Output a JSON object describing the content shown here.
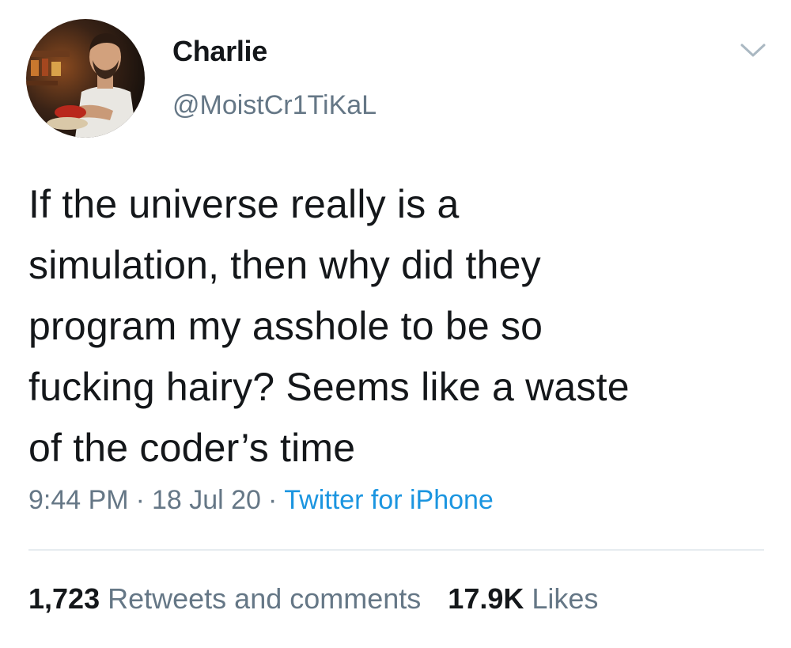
{
  "author": {
    "display_name": "Charlie",
    "handle": "@MoistCr1TiKaL",
    "avatar_icon": "profile-photo"
  },
  "menu": {
    "icon": "chevron-down-icon",
    "color": "#aab8c2"
  },
  "tweet": {
    "text_lines": [
      "If the universe really is a",
      "simulation, then why did they",
      "program my asshole to be so",
      "fucking hairy? Seems like a waste",
      "of the coder’s time"
    ],
    "time": "9:44 PM",
    "date": "18 Jul 20",
    "separator": "·",
    "source": "Twitter for iPhone"
  },
  "stats": {
    "retweets_count": "1,723",
    "retweets_label": "Retweets and comments",
    "likes_count": "17.9K",
    "likes_label": "Likes"
  },
  "colors": {
    "text": "#14171a",
    "secondary": "#657786",
    "link": "#1b95e0",
    "divider": "#e6ecf0"
  }
}
